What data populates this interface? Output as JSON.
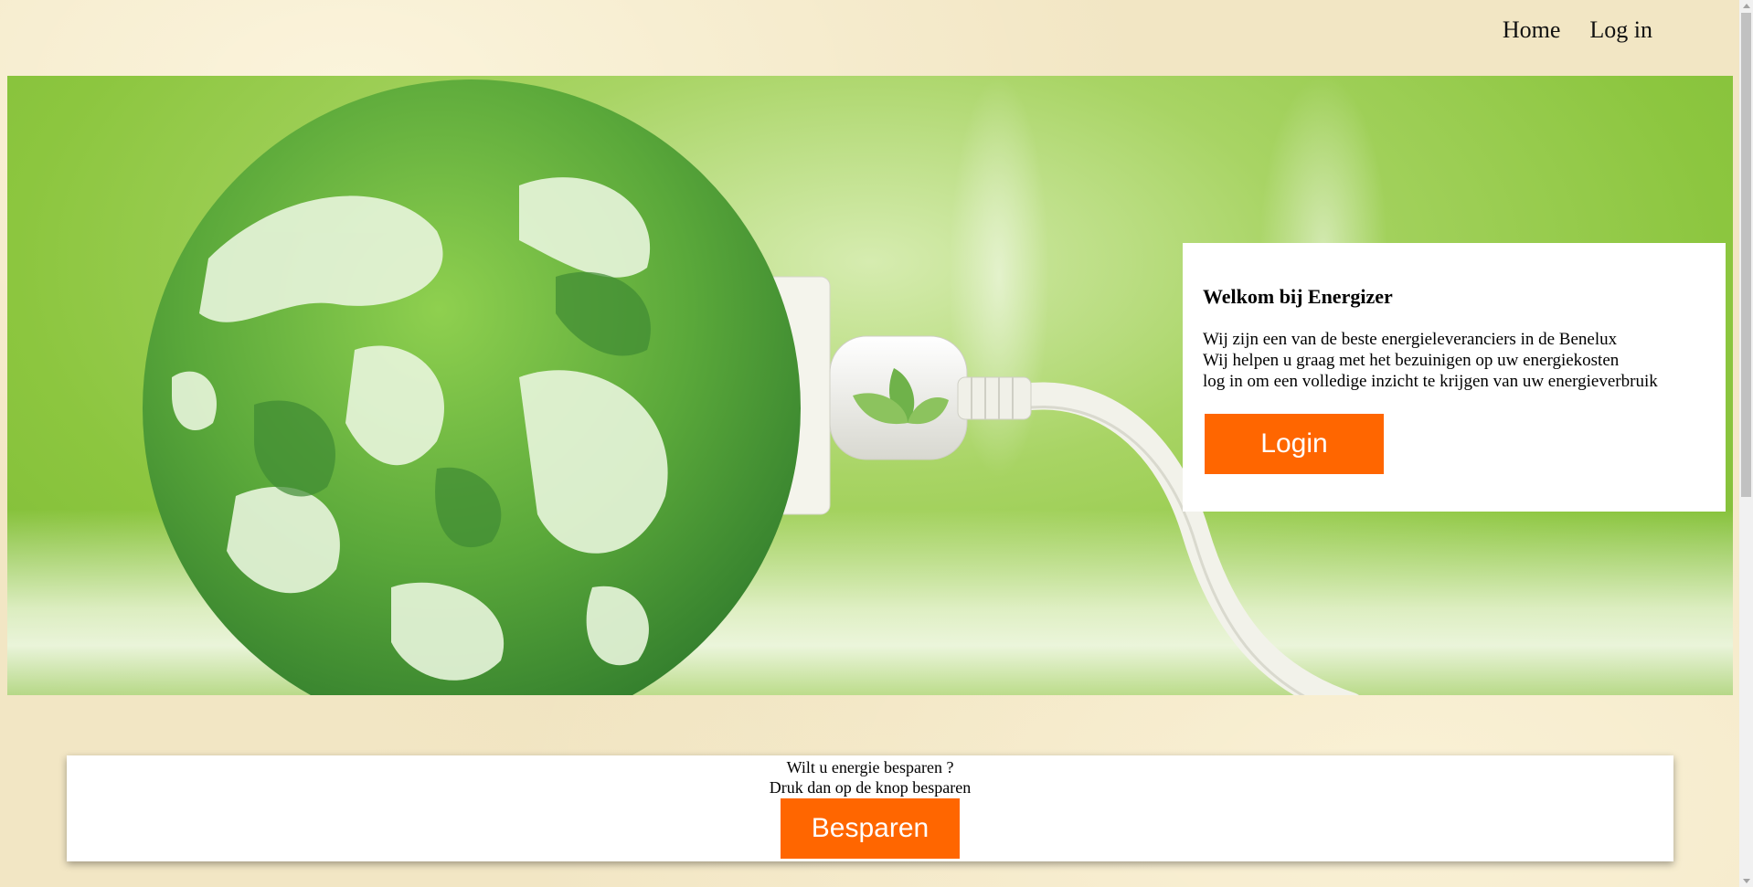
{
  "nav": {
    "home_label": "Home",
    "login_label": "Log in"
  },
  "welcome": {
    "title": "Welkom bij Energizer",
    "lines": [
      "Wij zijn een van de beste energieleveranciers in de Benelux",
      "Wij helpen u graag met het bezuinigen op uw energiekosten",
      "log in om een volledige inzicht te krijgen van uw energieverbruik"
    ],
    "button_label": "Login"
  },
  "savings": {
    "line1": "Wilt u energie besparen ?",
    "line2": "Druk dan op de knop besparen",
    "button_label": "Besparen"
  },
  "colors": {
    "accent": "#ff6600",
    "background": "#f2e6c4",
    "hero_green": "#8cc63f"
  }
}
